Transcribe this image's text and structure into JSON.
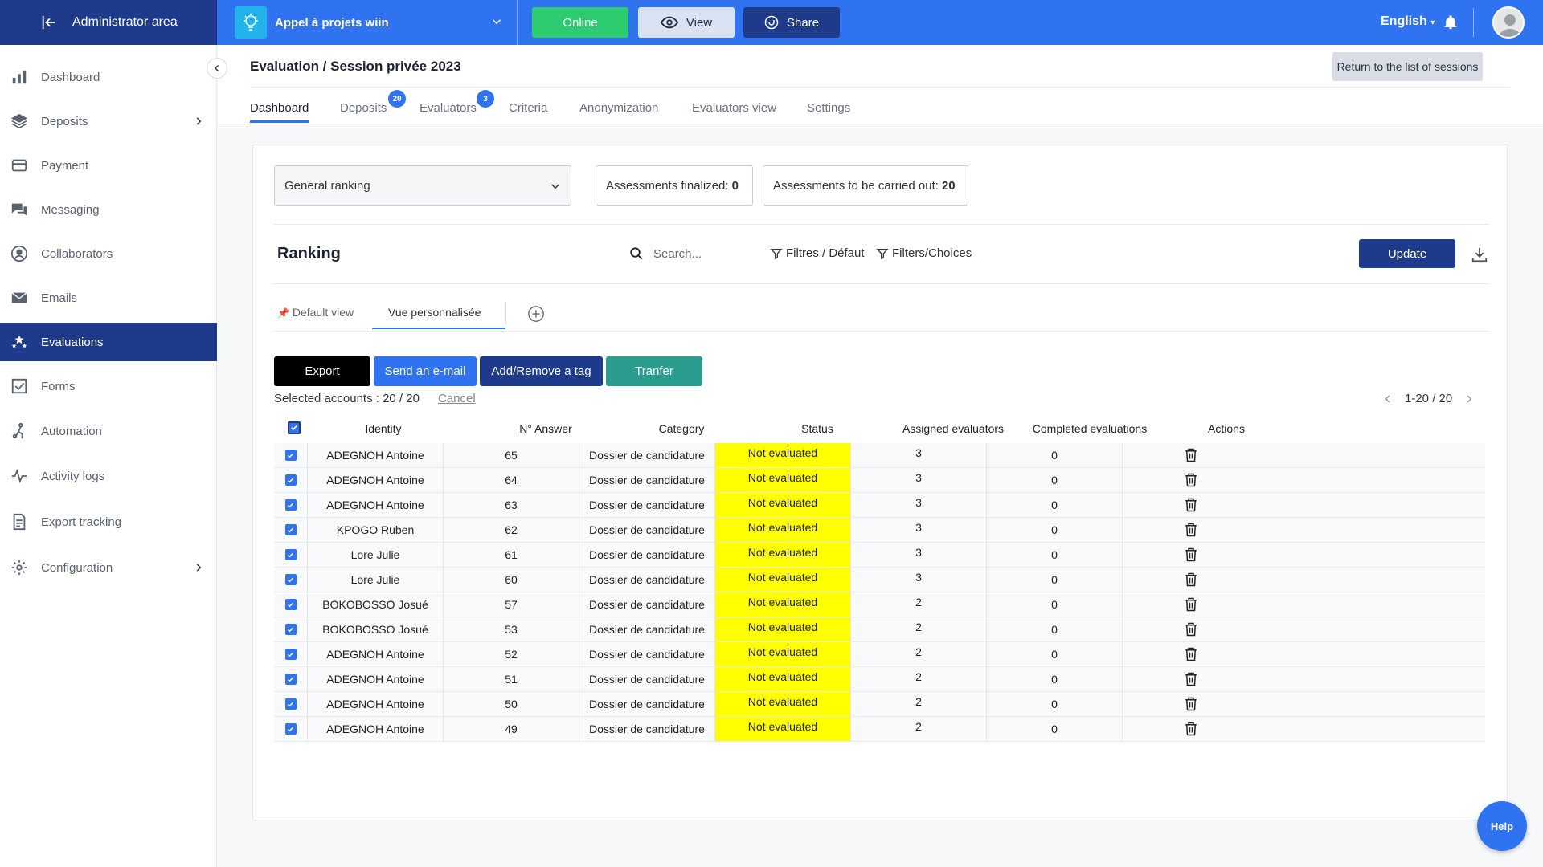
{
  "topbar": {
    "admin_label": "Administrator area",
    "project_name": "Appel à projets wiin",
    "online_label": "Online",
    "view_label": "View",
    "share_label": "Share",
    "language": "English"
  },
  "sidebar": {
    "items": [
      {
        "label": "Dashboard",
        "icon": "bar-chart-icon"
      },
      {
        "label": "Deposits",
        "icon": "layers-icon",
        "has_arrow": true
      },
      {
        "label": "Payment",
        "icon": "credit-card-icon"
      },
      {
        "label": "Messaging",
        "icon": "chat-icon"
      },
      {
        "label": "Collaborators",
        "icon": "user-circle-icon"
      },
      {
        "label": "Emails",
        "icon": "envelope-icon"
      },
      {
        "label": "Evaluations",
        "icon": "stars-icon",
        "active": true
      },
      {
        "label": "Forms",
        "icon": "checkbox-icon"
      },
      {
        "label": "Automation",
        "icon": "automation-icon"
      },
      {
        "label": "Activity logs",
        "icon": "activity-icon"
      },
      {
        "label": "Export tracking",
        "icon": "document-icon"
      },
      {
        "label": "Configuration",
        "icon": "gear-icon",
        "has_arrow": true
      }
    ]
  },
  "header": {
    "breadcrumb": "Evaluation / Session privée 2023",
    "return_label": "Return to the list of sessions",
    "tabs": [
      {
        "label": "Dashboard",
        "active": true
      },
      {
        "label": "Deposits",
        "badge": "20"
      },
      {
        "label": "Evaluators",
        "badge": "3"
      },
      {
        "label": "Criteria"
      },
      {
        "label": "Anonymization"
      },
      {
        "label": "Evaluators view"
      },
      {
        "label": "Settings"
      }
    ]
  },
  "main": {
    "ranking_select": "General ranking",
    "finalized_label": "Assessments finalized:",
    "finalized_value": "0",
    "to_carry_label": "Assessments to be carried out:",
    "to_carry_value": "20",
    "ranking_title": "Ranking",
    "search_placeholder": "Search...",
    "filter_default": "Filtres / Défaut",
    "filter_choices": "Filters/Choices",
    "update_label": "Update",
    "views": {
      "default": "Default view",
      "custom": "Vue personnalisée"
    },
    "actions": {
      "export": "Export",
      "send_email": "Send an e-mail",
      "tag": "Add/Remove a tag",
      "transfer": "Tranfer"
    },
    "selected_accounts": "Selected accounts : 20 / 20",
    "cancel": "Cancel",
    "pagination": "1-20 / 20"
  },
  "table": {
    "columns": [
      "Identity",
      "N° Answer",
      "Category",
      "Status",
      "Assigned evaluators",
      "Completed evaluations",
      "Actions"
    ],
    "rows": [
      {
        "identity": "ADEGNOH Antoine",
        "answer": "65",
        "category": "Dossier de candidature",
        "status": "Not evaluated",
        "assigned": "3",
        "completed": "0"
      },
      {
        "identity": "ADEGNOH Antoine",
        "answer": "64",
        "category": "Dossier de candidature",
        "status": "Not evaluated",
        "assigned": "3",
        "completed": "0"
      },
      {
        "identity": "ADEGNOH Antoine",
        "answer": "63",
        "category": "Dossier de candidature",
        "status": "Not evaluated",
        "assigned": "3",
        "completed": "0"
      },
      {
        "identity": "KPOGO Ruben",
        "answer": "62",
        "category": "Dossier de candidature",
        "status": "Not evaluated",
        "assigned": "3",
        "completed": "0"
      },
      {
        "identity": "Lore Julie",
        "answer": "61",
        "category": "Dossier de candidature",
        "status": "Not evaluated",
        "assigned": "3",
        "completed": "0"
      },
      {
        "identity": "Lore Julie",
        "answer": "60",
        "category": "Dossier de candidature",
        "status": "Not evaluated",
        "assigned": "3",
        "completed": "0"
      },
      {
        "identity": "BOKOBOSSO Josué",
        "answer": "57",
        "category": "Dossier de candidature",
        "status": "Not evaluated",
        "assigned": "2",
        "completed": "0"
      },
      {
        "identity": "BOKOBOSSO Josué",
        "answer": "53",
        "category": "Dossier de candidature",
        "status": "Not evaluated",
        "assigned": "2",
        "completed": "0"
      },
      {
        "identity": "ADEGNOH Antoine",
        "answer": "52",
        "category": "Dossier de candidature",
        "status": "Not evaluated",
        "assigned": "2",
        "completed": "0"
      },
      {
        "identity": "ADEGNOH Antoine",
        "answer": "51",
        "category": "Dossier de candidature",
        "status": "Not evaluated",
        "assigned": "2",
        "completed": "0"
      },
      {
        "identity": "ADEGNOH Antoine",
        "answer": "50",
        "category": "Dossier de candidature",
        "status": "Not evaluated",
        "assigned": "2",
        "completed": "0"
      },
      {
        "identity": "ADEGNOH Antoine",
        "answer": "49",
        "category": "Dossier de candidature",
        "status": "Not evaluated",
        "assigned": "2",
        "completed": "0"
      }
    ]
  },
  "help_label": "Help",
  "colors": {
    "primary": "#2f73f0",
    "navy": "#1e3a8a",
    "online": "#2ecc71",
    "transfer": "#2a9d8f",
    "status_bg": "#ffff00"
  }
}
